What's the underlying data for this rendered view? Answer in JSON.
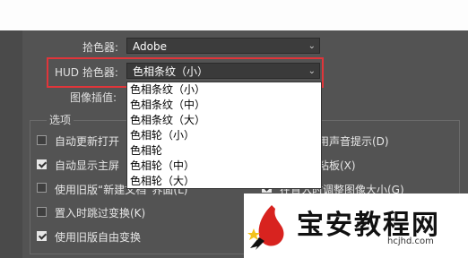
{
  "color_picker": {
    "label": "拾色器:",
    "value": "Adobe"
  },
  "hud_picker": {
    "label": "HUD 拾色器:",
    "value": "色相条纹（小）"
  },
  "interpolation": {
    "label": "图像插值:"
  },
  "options": {
    "title": "选项",
    "items": [
      {
        "label": "自动更新打开",
        "checked": false
      },
      {
        "label": "用声音提示(D)",
        "checked": false
      },
      {
        "label": "自动显示主屏",
        "checked": true
      },
      {
        "label": "粘板(X)",
        "checked": false
      },
      {
        "label": "使用旧版“新建文档”界面(L)",
        "checked": false
      },
      {
        "label": "在置入时调整图像大小(G)",
        "checked": true
      },
      {
        "label": "置入时跳过变换(K)",
        "checked": false
      },
      {
        "label": "使用旧版自由变换",
        "checked": true
      }
    ]
  },
  "dropdown_options": [
    "色相条纹（小）",
    "色相条纹（中）",
    "色相条纹（大）",
    "色相轮（小）",
    "色相轮",
    "色相轮（中）",
    "色相轮（大）"
  ],
  "watermark": {
    "title": "宝安教程网",
    "url": "hcjhd.com"
  },
  "colors": {
    "panel_bg": "#535353",
    "highlight": "#e0353a",
    "accent_red": "#d8231f"
  }
}
